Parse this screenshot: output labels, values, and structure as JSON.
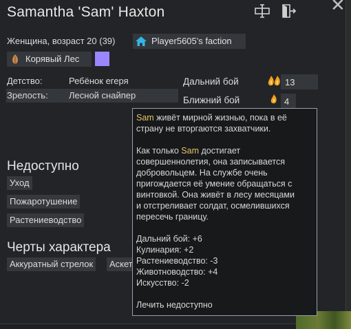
{
  "window": {
    "name": "Samantha 'Sam' Haxton",
    "close_glyph": "✕"
  },
  "info": {
    "gender_age": "Женщина, возраст 20 (39)",
    "faction": "Player5605's faction",
    "origin": "Корявый Лес",
    "faction_color": "#9b86ff"
  },
  "backstory": {
    "childhood_label": "Детство:",
    "childhood_value": "Ребёнок егеря",
    "adulthood_label": "Зрелость:",
    "adulthood_value": "Лесной снайпер"
  },
  "skills": {
    "ranged_label": "Дальний бой",
    "ranged_value": "13",
    "melee_label": "Ближний бой",
    "melee_value": "4"
  },
  "incapable": {
    "title": "Недоступно",
    "items": [
      "Уход",
      "Пожаротушение",
      "Растениеводство"
    ]
  },
  "traits": {
    "title": "Черты характера",
    "items": [
      "Аккуратный стрелок",
      "Аскет"
    ]
  },
  "tooltip": {
    "p1_name": "Sam",
    "p1_line1_rest": " живёт мирной жизнью, пока в её",
    "p1_line2": "страну не вторгаются захватчики.",
    "p2_line1_pre": "Как только ",
    "p2_name": "Sam",
    "p2_line1_post": " достигает",
    "p2_line2": "совершеннолетия, она записывается",
    "p2_line3": "добровольцем. На службе очень",
    "p2_line4": "пригождается её умение обращаться с",
    "p2_line5": "винтовкой. Она живёт в лесу месяцами",
    "p2_line6": "и отстреливает солдат, осмелившихся",
    "p2_line7": "пересечь границу.",
    "mods": [
      "Дальний бой: +6",
      "Кулинария: +2",
      "Растениеводство: -3",
      "Животноводство: +4",
      "Искусство: -2"
    ],
    "disabled": "Лечить недоступно"
  },
  "icons": {
    "rename": "rename-icon",
    "banish": "banish-icon",
    "close": "close-icon",
    "faction": "house-icon",
    "origin": "leaf-icon",
    "passion_major": "double-flame-icon",
    "passion_minor": "flame-icon"
  }
}
